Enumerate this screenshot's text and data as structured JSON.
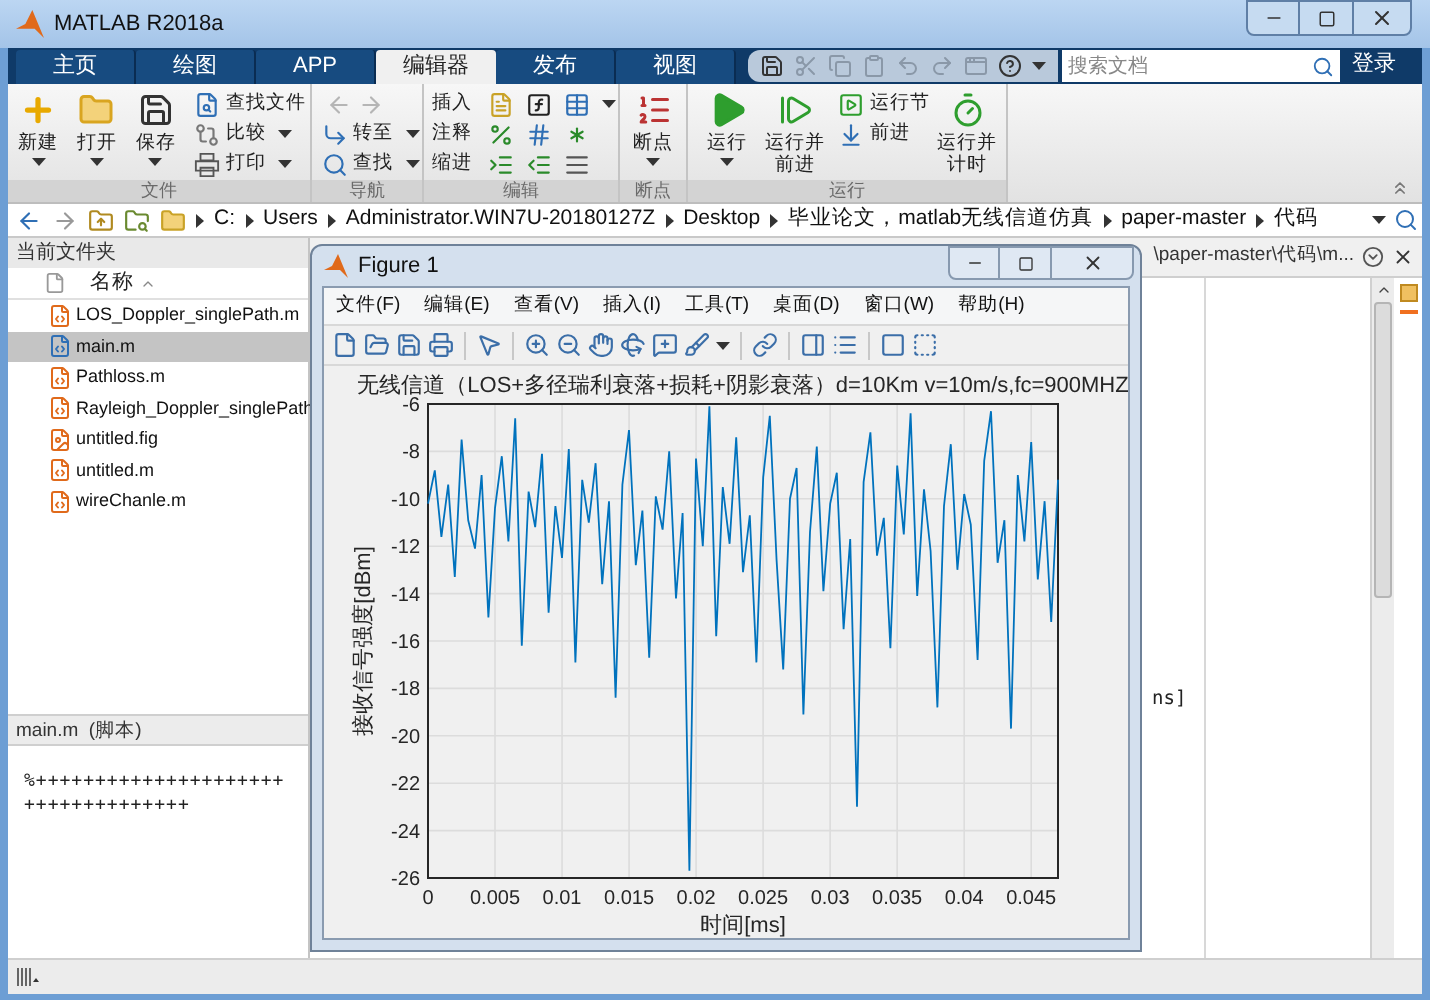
{
  "window": {
    "title": "MATLAB R2018a"
  },
  "tabs": [
    {
      "label": "主页",
      "selected": false
    },
    {
      "label": "绘图",
      "selected": false
    },
    {
      "label": "APP",
      "selected": false
    },
    {
      "label": "编辑器",
      "selected": true
    },
    {
      "label": "发布",
      "selected": false
    },
    {
      "label": "视图",
      "selected": false
    }
  ],
  "search": {
    "placeholder": "搜索文档"
  },
  "sign_in": "登录",
  "ribbon": [
    {
      "label": "文件",
      "items": [
        {
          "kind": "large",
          "label": "新建",
          "menu": true
        },
        {
          "kind": "large",
          "label": "打开",
          "menu": true
        },
        {
          "kind": "large",
          "label": "保存",
          "menu": true
        },
        {
          "kind": "small",
          "label": "查找文件",
          "menu": false
        },
        {
          "kind": "small",
          "label": "比较",
          "menu": true
        },
        {
          "kind": "small",
          "label": "打印",
          "menu": true
        }
      ]
    },
    {
      "label": "导航",
      "items": [
        {
          "kind": "arrows",
          "disabled": true
        },
        {
          "kind": "small",
          "label": "转至",
          "menu": true
        },
        {
          "kind": "small",
          "label": "查找",
          "menu": true
        }
      ]
    },
    {
      "label": "编辑",
      "items": [
        {
          "kind": "row",
          "label": "插入",
          "menu": true
        },
        {
          "kind": "row",
          "label": "注释",
          "menu": false
        },
        {
          "kind": "row",
          "label": "缩进",
          "menu": false
        }
      ]
    },
    {
      "label": "断点",
      "items": [
        {
          "kind": "large",
          "label": "断点",
          "menu": true
        }
      ]
    },
    {
      "label": "运行",
      "items": [
        {
          "kind": "large",
          "label": "运行",
          "menu": true
        },
        {
          "kind": "large",
          "label": "运行并前进",
          "menu": false
        },
        {
          "kind": "small",
          "label": "运行节",
          "menu": false
        },
        {
          "kind": "small",
          "label": "前进",
          "menu": false
        },
        {
          "kind": "large",
          "label": "运行并计时",
          "menu": false
        }
      ]
    }
  ],
  "address": {
    "segments": [
      "C:",
      "Users",
      "Administrator.WIN7U-20180127Z",
      "Desktop",
      "毕业论文，matlab无线信道仿真",
      "paper-master",
      "代码"
    ]
  },
  "files": {
    "title": "当前文件夹",
    "column": "名称",
    "items": [
      {
        "name": "LOS_Doppler_singlePath.m",
        "kind": "m",
        "selected": false
      },
      {
        "name": "main.m",
        "kind": "script",
        "selected": true
      },
      {
        "name": "Pathloss.m",
        "kind": "m",
        "selected": false
      },
      {
        "name": "Rayleigh_Doppler_singlePath",
        "kind": "m",
        "selected": false
      },
      {
        "name": "untitled.fig",
        "kind": "fig",
        "selected": false
      },
      {
        "name": "untitled.m",
        "kind": "m",
        "selected": false
      },
      {
        "name": "wireChanle.m",
        "kind": "m",
        "selected": false
      }
    ]
  },
  "details": {
    "title": "main.m  (脚本)",
    "lines": [
      "%+++++++++++++++++++++",
      "++++++++++++++"
    ]
  },
  "editor": {
    "path": "\\paper-master\\代码\\m...",
    "visible_text": "ns]"
  },
  "figure": {
    "title": "Figure 1",
    "menu": [
      "文件(F)",
      "编辑(E)",
      "查看(V)",
      "插入(I)",
      "工具(T)",
      "桌面(D)",
      "窗口(W)",
      "帮助(H)"
    ],
    "plot": {
      "chart_data": {
        "type": "line",
        "title": "无线信道（LOS+多径瑞利衰落+损耗+阴影衰落）d=10Km v=10m/s,fc=900MHZ",
        "xlabel": "时间[ms]",
        "ylabel": "接收信号强度[dBm]",
        "x": [
          0,
          0.0005,
          0.001,
          0.0015,
          0.002,
          0.0025,
          0.003,
          0.0035,
          0.004,
          0.0045,
          0.005,
          0.0055,
          0.006,
          0.0065,
          0.007,
          0.0075,
          0.008,
          0.0085,
          0.009,
          0.0095,
          0.01,
          0.0105,
          0.011,
          0.0115,
          0.012,
          0.0125,
          0.013,
          0.0135,
          0.014,
          0.0145,
          0.015,
          0.0155,
          0.016,
          0.0165,
          0.017,
          0.0175,
          0.018,
          0.0185,
          0.019,
          0.0195,
          0.02,
          0.0205,
          0.021,
          0.0215,
          0.022,
          0.0225,
          0.023,
          0.0235,
          0.024,
          0.0245,
          0.025,
          0.0255,
          0.026,
          0.0265,
          0.027,
          0.0275,
          0.028,
          0.0285,
          0.029,
          0.0295,
          0.03,
          0.0305,
          0.031,
          0.0315,
          0.032,
          0.0325,
          0.033,
          0.0335,
          0.034,
          0.0345,
          0.035,
          0.0355,
          0.036,
          0.0365,
          0.037,
          0.0375,
          0.038,
          0.0385,
          0.039,
          0.0395,
          0.04,
          0.0405,
          0.041,
          0.0415,
          0.042,
          0.0425,
          0.043,
          0.0435,
          0.044,
          0.0445,
          0.045,
          0.0455,
          0.046,
          0.0465,
          0.047
        ],
        "series": [
          {
            "color": "#0072bd",
            "values": [
              -10.2,
              -8.8,
              -11.6,
              -9.4,
              -13.3,
              -7.5,
              -10.9,
              -12.1,
              -9.0,
              -15.0,
              -10.4,
              -8.2,
              -11.8,
              -6.6,
              -16.2,
              -9.7,
              -11.2,
              -8.1,
              -14.8,
              -10.3,
              -12.5,
              -7.9,
              -16.9,
              -9.2,
              -11.0,
              -8.5,
              -13.6,
              -10.1,
              -18.4,
              -9.4,
              -7.1,
              -12.8,
              -10.5,
              -16.7,
              -9.9,
              -11.3,
              -8.0,
              -14.2,
              -10.6,
              -25.7,
              -8.3,
              -12.0,
              -6.1,
              -15.8,
              -9.5,
              -11.9,
              -7.4,
              -13.1,
              -10.7,
              -16.9,
              -9.1,
              -6.5,
              -12.6,
              -17.2,
              -10.0,
              -8.7,
              -19.1,
              -11.4,
              -7.8,
              -13.9,
              -10.2,
              -8.9,
              -15.5,
              -11.7,
              -23.0,
              -9.3,
              -7.2,
              -12.4,
              -10.8,
              -16.3,
              -8.6,
              -11.5,
              -6.4,
              -14.1,
              -9.6,
              -12.2,
              -18.8,
              -10.3,
              -7.7,
              -13.0,
              -9.8,
              -11.1,
              -16.8,
              -8.4,
              -6.3,
              -12.7,
              -10.9,
              -19.7,
              -9.0,
              -11.8,
              -7.6,
              -13.4,
              -10.1,
              -15.2,
              -9.2
            ]
          }
        ],
        "xlim": [
          0,
          0.047
        ],
        "ylim": [
          -26,
          -6
        ],
        "grid": true,
        "xticks": [
          0,
          0.005,
          0.01,
          0.015,
          0.02,
          0.025,
          0.03,
          0.035,
          0.04,
          0.045
        ],
        "yticks": [
          -6,
          -8,
          -10,
          -12,
          -14,
          -16,
          -18,
          -20,
          -22,
          -24,
          -26
        ]
      }
    }
  }
}
